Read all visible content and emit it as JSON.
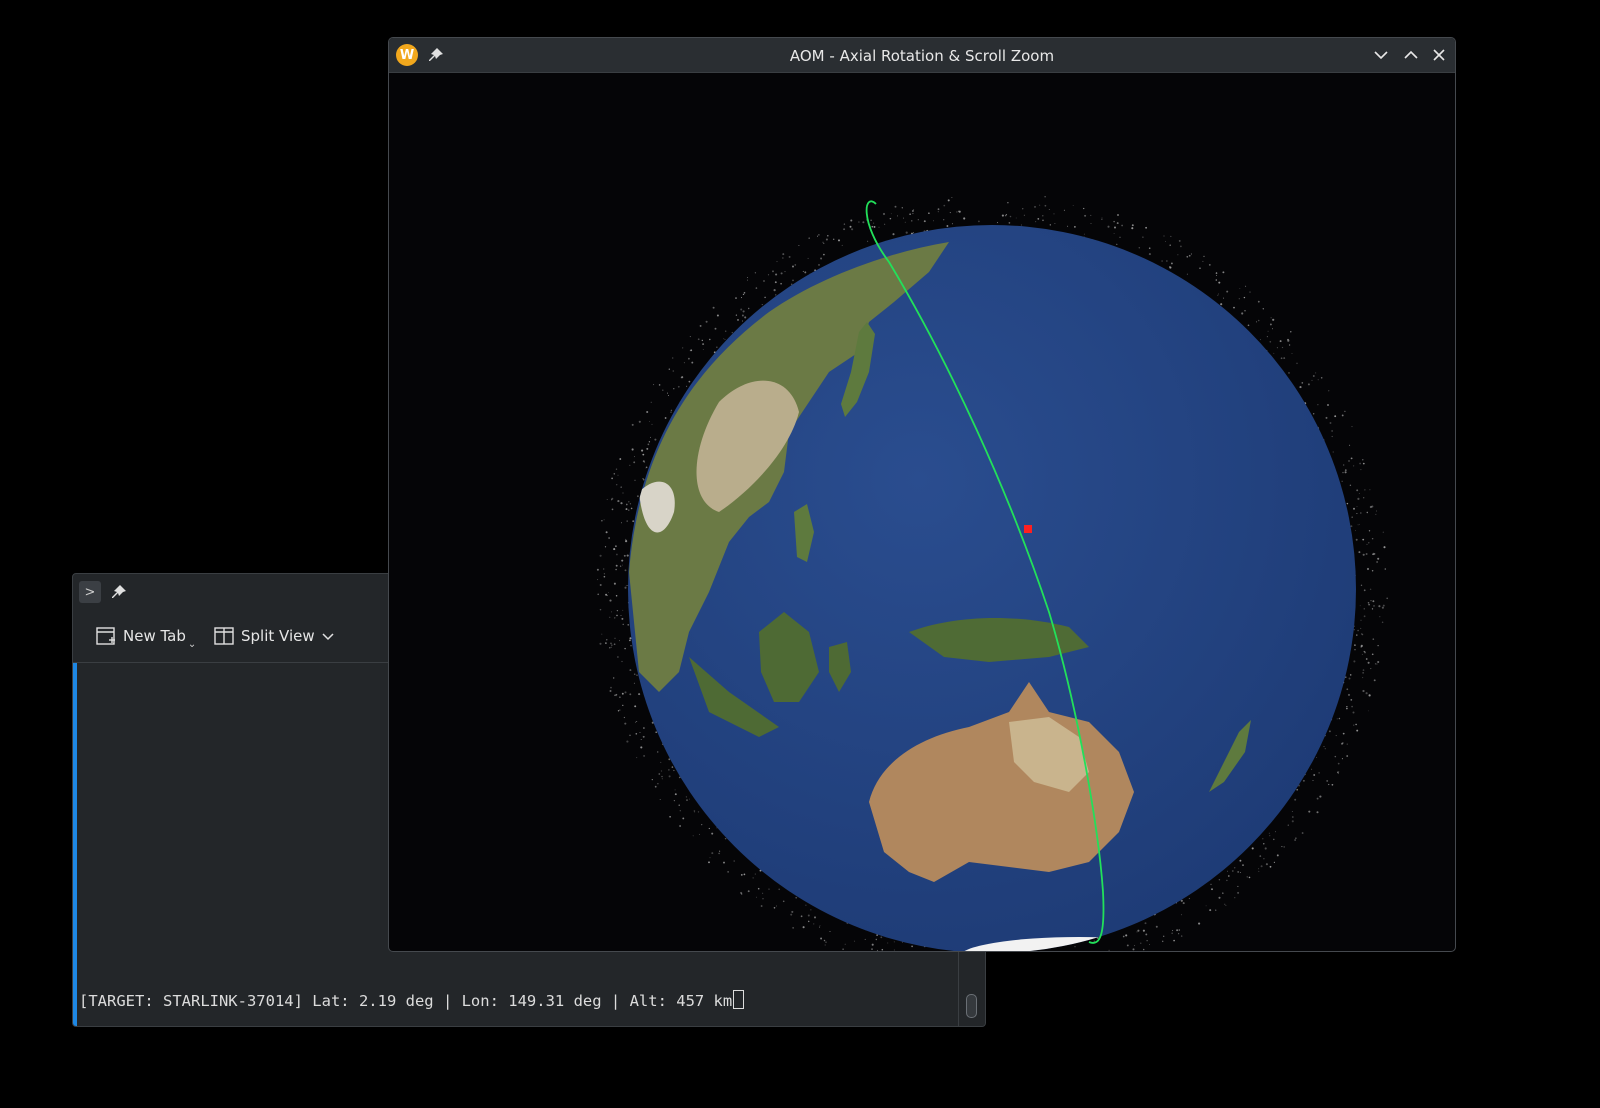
{
  "terminal": {
    "toolbar": {
      "new_tab_label": "New Tab",
      "split_view_label": "Split View"
    },
    "output_line": "[TARGET: STARLINK-37014] Lat: 2.19 deg | Lon: 149.31 deg | Alt: 457 km"
  },
  "globe_window": {
    "title": "AOM - Axial Rotation & Scroll Zoom",
    "app_icon_letter": "W",
    "colors": {
      "ocean": "#22417e",
      "orbit_track": "#22e05a",
      "target_marker": "#ff2020",
      "debris": "#bdbdbd"
    },
    "target": {
      "name": "STARLINK-37014",
      "lat_deg": 2.19,
      "lon_deg": 149.31,
      "alt_km": 457
    }
  }
}
